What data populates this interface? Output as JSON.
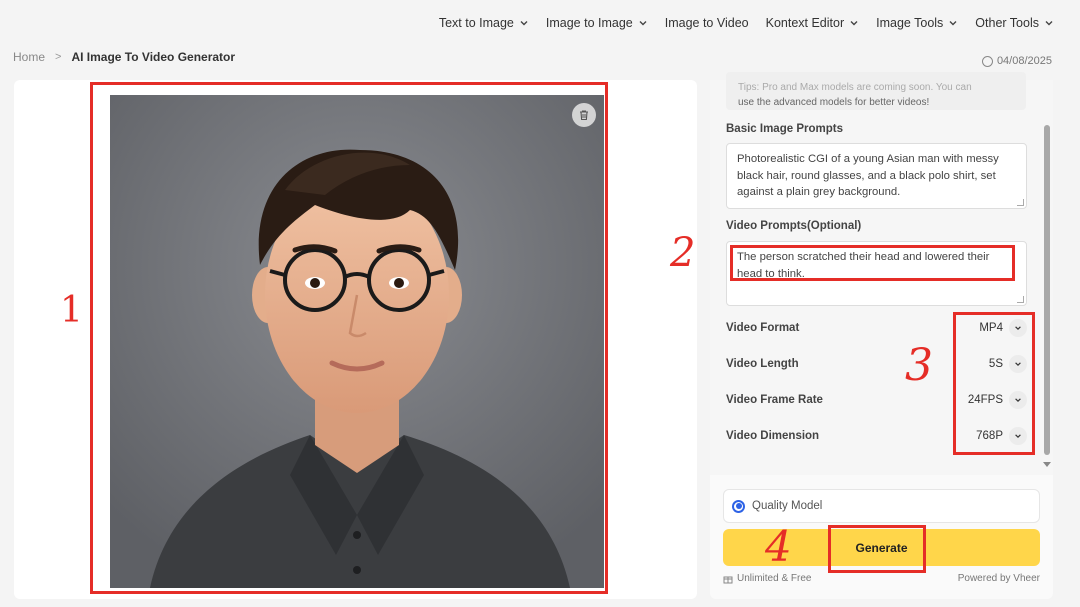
{
  "nav": {
    "items": [
      {
        "label": "Text to Image",
        "dropdown": true
      },
      {
        "label": "Image to Image",
        "dropdown": true
      },
      {
        "label": "Image to Video",
        "dropdown": false
      },
      {
        "label": "Kontext Editor",
        "dropdown": true
      },
      {
        "label": "Image Tools",
        "dropdown": true
      },
      {
        "label": "Other Tools",
        "dropdown": true
      }
    ]
  },
  "breadcrumb": {
    "home": "Home",
    "separator": ">",
    "current": "AI Image To Video Generator"
  },
  "date": "04/08/2025",
  "tips": {
    "line1": "Tips: Pro and Max models are coming soon. You can",
    "line2": "use the advanced models for better videos!"
  },
  "form": {
    "basic_label": "Basic Image Prompts",
    "basic_value": "Photorealistic CGI of a young Asian man with messy black hair, round glasses, and a black polo shirt, set against a plain grey background.",
    "video_label": "Video Prompts(Optional)",
    "video_value": "The person scratched their head and lowered their head to think.",
    "settings": [
      {
        "label": "Video Format",
        "value": "MP4"
      },
      {
        "label": "Video Length",
        "value": "5S"
      },
      {
        "label": "Video Frame Rate",
        "value": "24FPS"
      },
      {
        "label": "Video Dimension",
        "value": "768P"
      }
    ]
  },
  "quality_model": "Quality Model",
  "generate_label": "Generate",
  "footer": {
    "left": "Unlimited & Free",
    "right": "Powered by Vheer"
  },
  "annotations": {
    "m1": "1",
    "m2": "2",
    "m3": "3",
    "m4": "4"
  },
  "colors": {
    "accent_yellow": "#ffd64a",
    "radio_blue": "#2e63e6",
    "annotation_red": "#e52d27"
  }
}
